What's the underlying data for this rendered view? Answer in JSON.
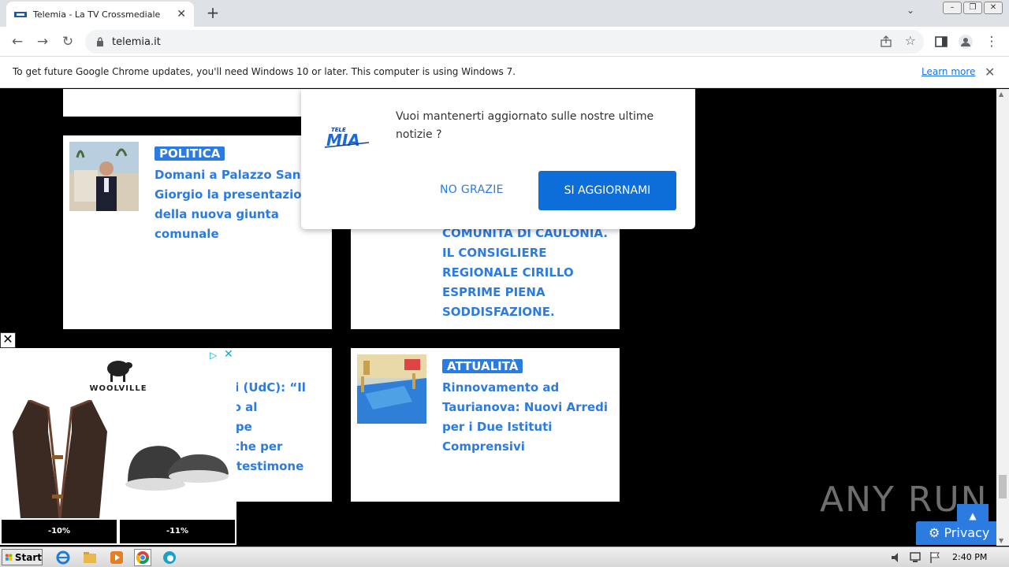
{
  "browser": {
    "tab_title": "Telemia - La TV Crossmediale",
    "url": "telemia.it",
    "new_tab": "+",
    "infobar_message": "To get future Google Chrome updates, you'll need Windows 10 or later. This computer is using Windows 7.",
    "learn_more": "Learn more"
  },
  "cards": [
    {
      "category": "POLITICA",
      "headline_lines": [
        "Domani a Palazzo San",
        "Giorgio la presentazione",
        "della nuova giunta",
        "comunale"
      ]
    },
    {
      "category": "",
      "headline_lines": [
        "COMUNITÀ DI CAULONIA.",
        "IL CONSIGLIERE",
        "REGIONALE CIRILLO",
        "ESPRIME PIENA",
        "SODDISFAZIONE."
      ]
    },
    {
      "category": "",
      "headline_lines": [
        "ziali (UdC): “Il",
        "ddio al",
        "seppe",
        "lui che per",
        "e il testimone",
        "”."
      ]
    },
    {
      "category": "ATTUALITÀ",
      "headline_lines": [
        "Rinnovamento ad",
        "Taurianova: Nuovi Arredi",
        "per i Due Istituti",
        "Comprensivi"
      ]
    }
  ],
  "popup": {
    "message": "Vuoi mantenerti aggiornato sulle nostre ultime notizie ?",
    "decline": "NO GRAZIE",
    "accept": "SI AGGIORNAMI",
    "logo_text": "TELE MIA"
  },
  "ad": {
    "brand": "WOOLVILLE",
    "discount_left": "-10%",
    "discount_right": "-11%"
  },
  "privacy_label": "Privacy",
  "watermark": "ANY RUN",
  "taskbar": {
    "start_label": "Start",
    "clock": "2:40 PM"
  },
  "colors": {
    "accent": "#2c7be0",
    "button": "#0d6ed9"
  }
}
